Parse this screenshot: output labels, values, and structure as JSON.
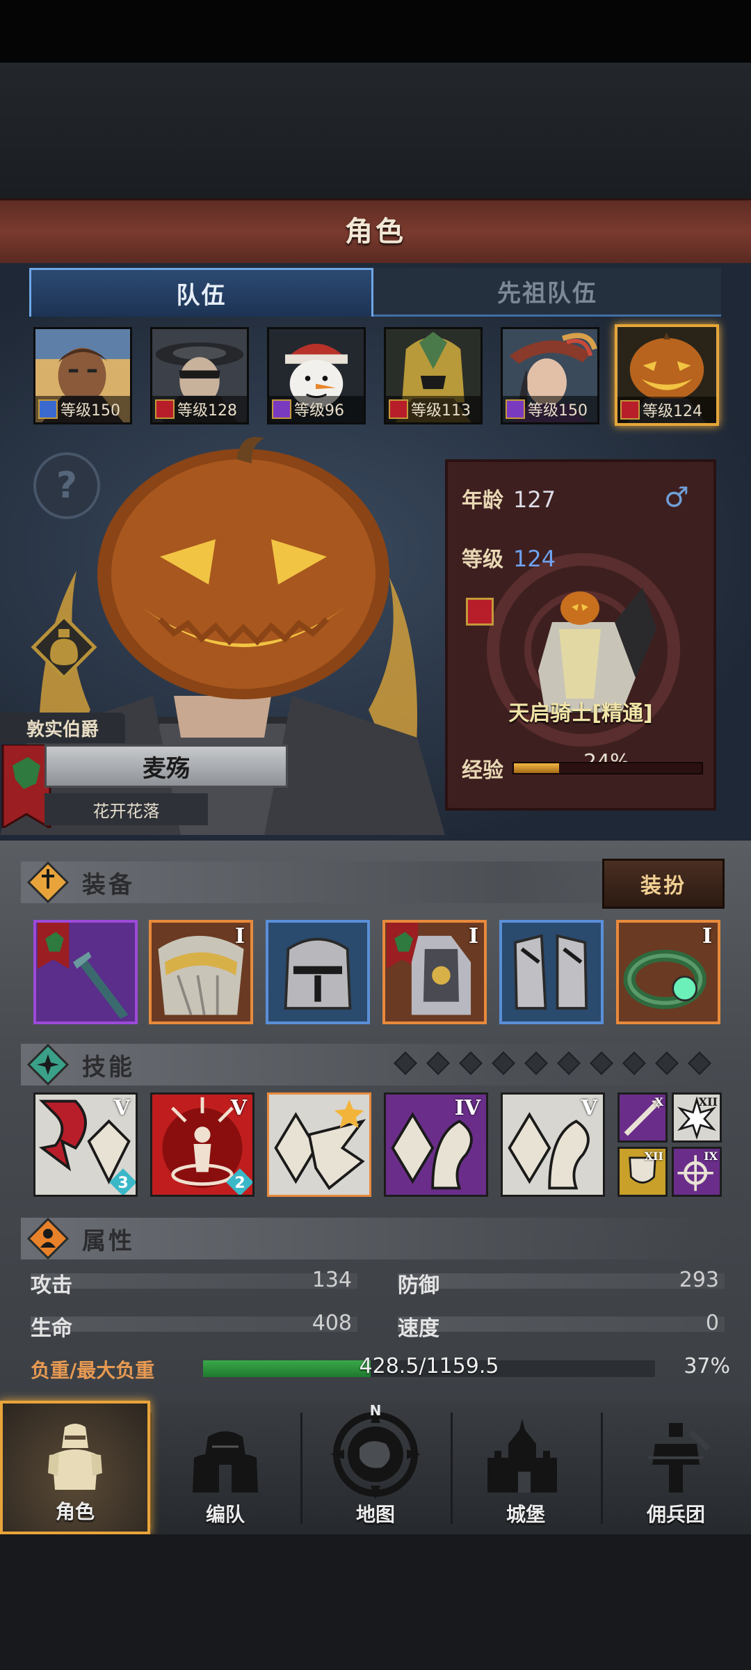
{
  "header": {
    "title": "角色"
  },
  "tabs": [
    {
      "label": "队伍",
      "active": true
    },
    {
      "label": "先祖队伍",
      "active": false
    }
  ],
  "heroes": [
    {
      "level_text": "等级150",
      "class_icon": "sword-icon",
      "selected": false
    },
    {
      "level_text": "等级128",
      "class_icon": "horse-icon",
      "selected": false
    },
    {
      "level_text": "等级96",
      "class_icon": "staff-icon",
      "selected": false
    },
    {
      "level_text": "等级113",
      "class_icon": "horse-icon",
      "selected": false
    },
    {
      "level_text": "等级150",
      "class_icon": "staff-icon",
      "selected": false
    },
    {
      "level_text": "等级124",
      "class_icon": "horse-icon",
      "selected": true
    }
  ],
  "character": {
    "title": "敦实伯爵",
    "name": "麦殇",
    "motto": "花开花落",
    "age_label": "年龄",
    "age": "127",
    "level_label": "等级",
    "level": "124",
    "gender_icon": "male-icon",
    "class_name": "天启骑士[精通]",
    "exp_label": "经验",
    "exp_text": "24%",
    "exp_percent": 24
  },
  "equipment": {
    "label": "装备",
    "dress_button": "装扮",
    "items": [
      {
        "icon": "lance-icon",
        "rarity": "epic",
        "tier": ""
      },
      {
        "icon": "shoulder-armor-icon",
        "rarity": "legendary",
        "tier": "I"
      },
      {
        "icon": "helmet-icon",
        "rarity": "rare",
        "tier": ""
      },
      {
        "icon": "plate-armor-icon",
        "rarity": "legendary",
        "tier": "I"
      },
      {
        "icon": "greaves-icon",
        "rarity": "rare",
        "tier": ""
      },
      {
        "icon": "ring-icon",
        "rarity": "legendary",
        "tier": "I"
      }
    ]
  },
  "skills": {
    "label": "技能",
    "slots_filled": 0,
    "slots_total": 10,
    "items": [
      {
        "icon": "charge-skill-icon",
        "tier": "V",
        "count": "3"
      },
      {
        "icon": "rally-skill-icon",
        "tier": "V",
        "count": "2"
      },
      {
        "icon": "crystal-wing-icon",
        "tier": "",
        "count": ""
      },
      {
        "icon": "crystal-arm-icon",
        "tier": "IV",
        "count": ""
      },
      {
        "icon": "crystal-arm-icon",
        "tier": "V",
        "count": ""
      }
    ],
    "passives": [
      {
        "icon": "spear-icon",
        "tier": "X"
      },
      {
        "icon": "burst-icon",
        "tier": "XII"
      },
      {
        "icon": "shield-icon",
        "tier": "XII"
      },
      {
        "icon": "target-icon",
        "tier": "IX"
      }
    ]
  },
  "attributes": {
    "label": "属性",
    "attack_label": "攻击",
    "attack": "134",
    "defense_label": "防御",
    "defense": "293",
    "hp_label": "生命",
    "hp": "408",
    "speed_label": "速度",
    "speed": "0",
    "load_label": "负重/最大负重",
    "load_text": "428.5/1159.5",
    "load_percent_text": "37%",
    "load_percent": 37
  },
  "nav": [
    {
      "label": "角色",
      "icon": "knight-icon",
      "active": true
    },
    {
      "label": "编队",
      "icon": "formation-icon",
      "active": false
    },
    {
      "label": "地图",
      "icon": "compass-icon",
      "active": false,
      "compass_letter": "N"
    },
    {
      "label": "城堡",
      "icon": "castle-icon",
      "active": false
    },
    {
      "label": "佣兵团",
      "icon": "mercenary-icon",
      "active": false
    }
  ],
  "colors": {
    "title_bar": "#7a3a2e",
    "tab_active": "#2c4a72",
    "selected_border": "#e6a63a",
    "rarity_epic": "#9c4ad8",
    "rarity_legendary": "#e88a3c",
    "rarity_rare": "#5a8fd8",
    "load_bar": "#3aa74a",
    "exp_bar": "#f2b744"
  }
}
